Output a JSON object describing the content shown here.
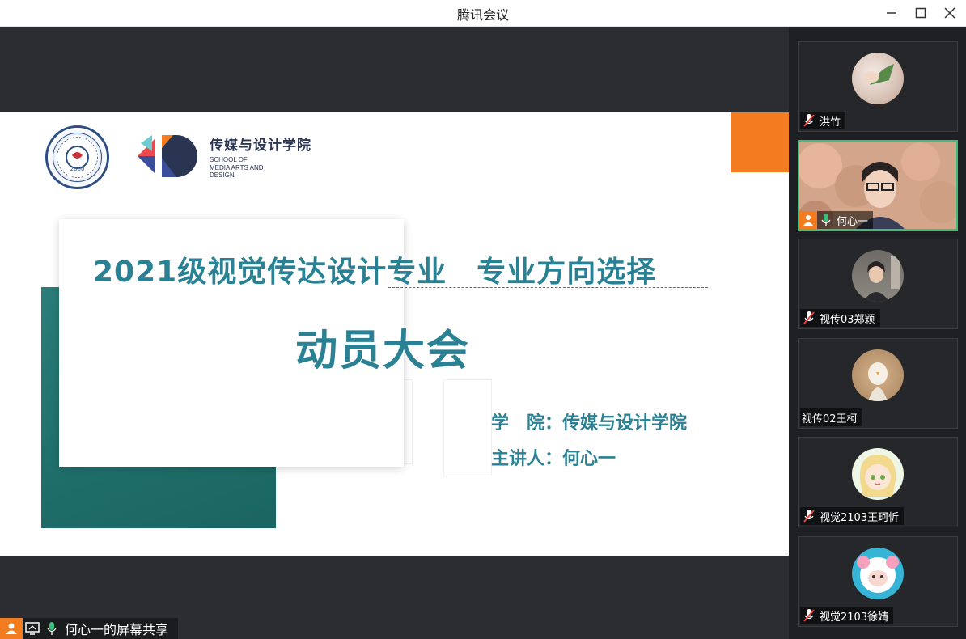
{
  "window": {
    "title": "腾讯会议",
    "minimize_icon": "minimize-icon",
    "maximize_icon": "maximize-icon",
    "close_icon": "close-icon"
  },
  "slide": {
    "school_name_cn": "传媒与设计学院",
    "school_name_en": [
      "SCHOOL OF",
      "MEDIA ARTS AND",
      "DESIGN"
    ],
    "main_title": "2021级视觉传达设计专业　专业方向选择",
    "sub_title": "动员大会",
    "college_line": "学　院：传媒与设计学院",
    "speaker_line": "主讲人：何心一",
    "colors": {
      "accent_teal": "#2a8193",
      "orange": "#f27c1f",
      "block_teal": "#1f6e6a"
    }
  },
  "share_bar": {
    "label": "何心一的屏幕共享",
    "icons": [
      "person-icon",
      "screen-share-icon",
      "mic-on-icon"
    ]
  },
  "participants": [
    {
      "name": "洪竹",
      "mic": "muted",
      "active": false
    },
    {
      "name": "何心一",
      "mic": "on",
      "active": true,
      "host": true
    },
    {
      "name": "视传03郑颖",
      "mic": "muted",
      "active": false
    },
    {
      "name": "视传02王柯",
      "mic": "none",
      "active": false
    },
    {
      "name": "视觉2103王珂忻",
      "mic": "muted",
      "active": false
    },
    {
      "name": "视觉2103徐婧",
      "mic": "muted",
      "active": false
    }
  ]
}
